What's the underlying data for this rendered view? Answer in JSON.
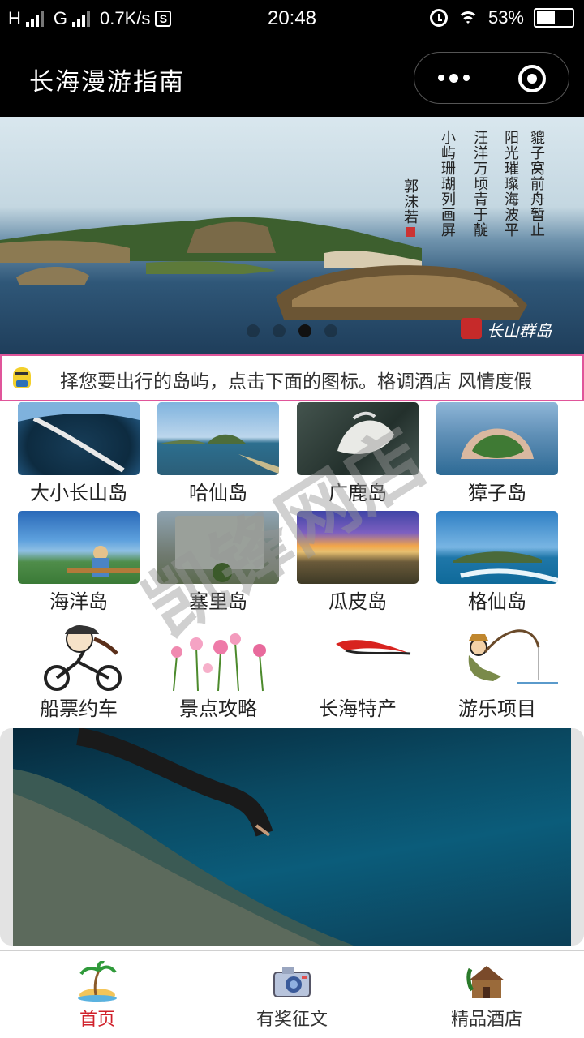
{
  "status_bar": {
    "carrier1": "H",
    "carrier2": "G",
    "speed": "0.7K/s",
    "s_badge": "S",
    "time": "20:48",
    "battery": "53%",
    "battery_level": 0.53
  },
  "header": {
    "title": "长海漫游指南"
  },
  "banner": {
    "poem_lines": [
      "貔子窝前舟暂止",
      "阳光璀璨海波平",
      "汪洋万顷青于靛",
      "小屿珊瑚列画屏"
    ],
    "author": "郭沫若",
    "logo": "长山群岛",
    "dot_count": 4,
    "active_dot": 2
  },
  "notice": {
    "text": "择您要出行的岛屿，点击下面的图标。格调酒店 风情度假"
  },
  "islands": [
    {
      "name": "大小长山岛"
    },
    {
      "name": "哈仙岛"
    },
    {
      "name": "广鹿岛"
    },
    {
      "name": "獐子岛"
    },
    {
      "name": "海洋岛"
    },
    {
      "name": "塞里岛"
    },
    {
      "name": "瓜皮岛"
    },
    {
      "name": "格仙岛"
    }
  ],
  "services": [
    {
      "name": "船票约车",
      "icon": "cyclist-icon"
    },
    {
      "name": "景点攻略",
      "icon": "flowers-icon"
    },
    {
      "name": "长海特产",
      "icon": "fish-icon"
    },
    {
      "name": "游乐项目",
      "icon": "fishing-icon"
    }
  ],
  "watermark": "凯锋网店",
  "tabs": [
    {
      "label": "首页",
      "icon": "palm-island-icon",
      "active": true
    },
    {
      "label": "有奖征文",
      "icon": "camera-icon",
      "active": false
    },
    {
      "label": "精品酒店",
      "icon": "cabin-icon",
      "active": false
    }
  ],
  "colors": {
    "accent_red": "#d0202a",
    "notice_border": "#e0559a",
    "header_bg": "#000000"
  }
}
